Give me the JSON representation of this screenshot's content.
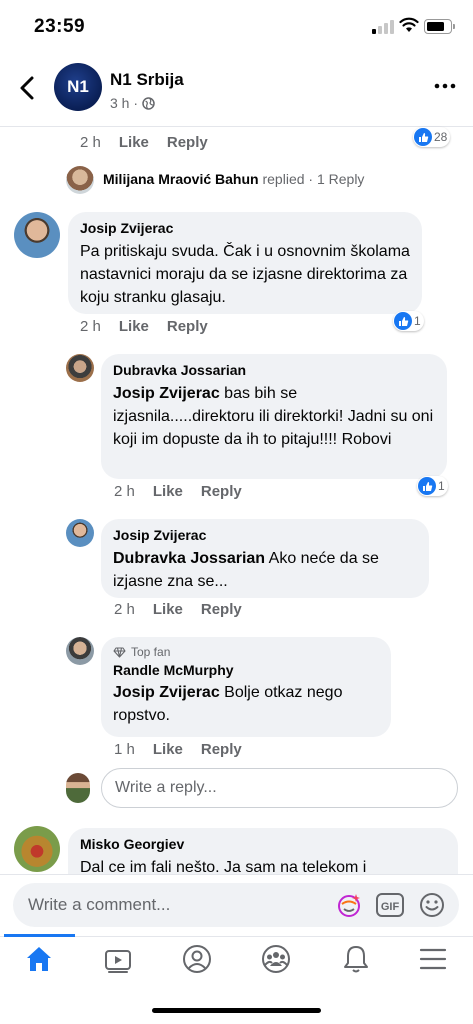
{
  "status_bar": {
    "time": "23:59"
  },
  "header": {
    "page_name": "N1 Srbija",
    "logo_text": "N1",
    "post_age": "3 h ·",
    "more_icon": "more-horizontal-icon"
  },
  "top_comment": {
    "time": "2 h",
    "like_label": "Like",
    "reply_label": "Reply",
    "reaction_count": "28"
  },
  "replied_summary": {
    "name": "Milijana Mraović Bahun",
    "replied_text": "replied",
    "reply_count": "· 1 Reply"
  },
  "comments": [
    {
      "author": "Josip Zvijerac",
      "text": "Pa pritiskaju svuda. Čak i u osnovnim školama nastavnici moraju da se izjasne direktorima za koju stranku glasaju.",
      "time": "2 h",
      "like_label": "Like",
      "reply_label": "Reply",
      "reaction_count": "1"
    },
    {
      "author": "Dubravka Jossarian",
      "mention": "Josip Zvijerac",
      "text": " bas bih se izjasnila.....direktoru ili direktorki! Jadni su oni koji im dopuste da ih to pitaju!!!! Robovi",
      "time": "2 h",
      "like_label": "Like",
      "reply_label": "Reply",
      "reaction_count": "1"
    },
    {
      "author": "Josip Zvijerac",
      "mention": "Dubravka Jossarian",
      "text": " Ako neće da se izjasne zna se...",
      "time": "2 h",
      "like_label": "Like",
      "reply_label": "Reply"
    },
    {
      "badge": "Top fan",
      "author": "Randle McMurphy",
      "mention": "Josip Zvijerac",
      "text": " Bolje otkaz nego ropstvo.",
      "time": "1 h",
      "like_label": "Like",
      "reply_label": "Reply"
    },
    {
      "author": "Misko Georgiev",
      "text": "Dal ce im fali nešto. Ja sam na telekom i"
    }
  ],
  "reply_input": {
    "placeholder": "Write a reply..."
  },
  "comment_input": {
    "placeholder": "Write a comment..."
  },
  "tabbar": {
    "items": [
      "home-icon",
      "watch-icon",
      "profile-icon",
      "groups-icon",
      "notifications-icon",
      "menu-icon"
    ],
    "active": "home-icon",
    "accent": "#1877f2"
  }
}
